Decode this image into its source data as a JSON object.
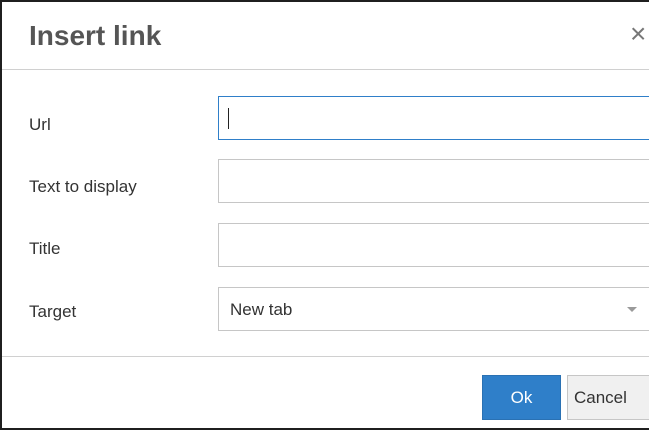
{
  "dialog": {
    "title": "Insert link",
    "close_symbol": "×"
  },
  "fields": {
    "url_label": "Url",
    "url_value": "",
    "text_label": "Text to display",
    "text_value": "",
    "title_label": "Title",
    "title_value": "",
    "target_label": "Target",
    "target_value": "New tab"
  },
  "buttons": {
    "ok_label": "Ok",
    "cancel_label": "Cancel"
  },
  "icons": {
    "close": "close-icon",
    "dropdown": "chevron-down-icon"
  },
  "colors": {
    "primary": "#2f7fc9",
    "focus_border": "#2f7fc9"
  }
}
